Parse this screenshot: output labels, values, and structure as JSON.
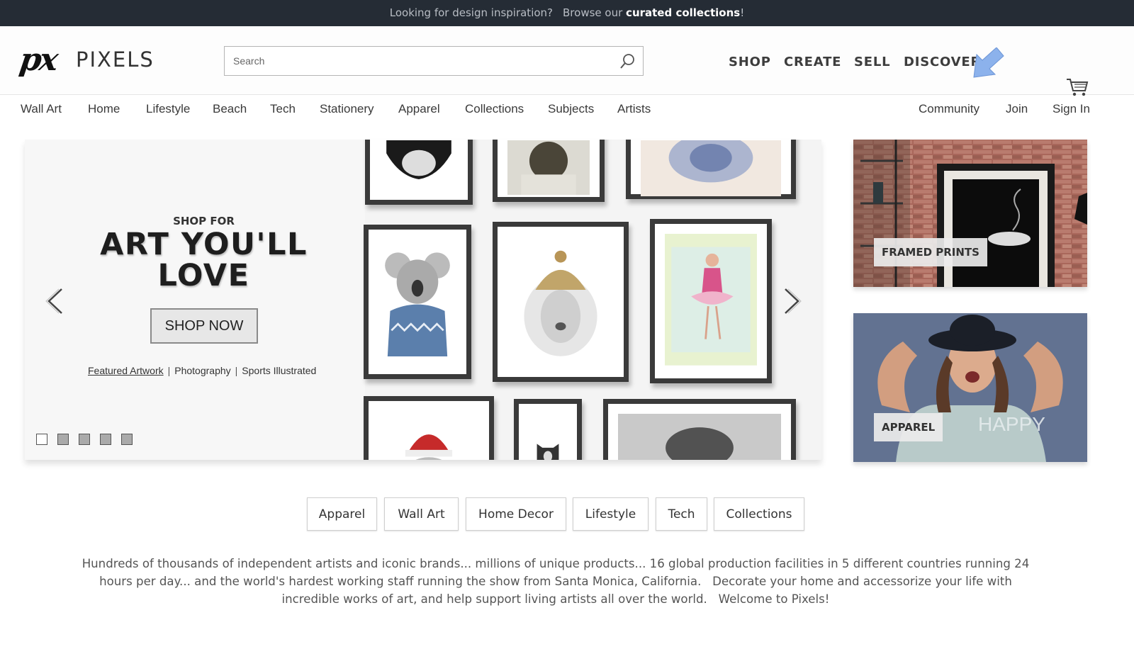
{
  "promo": {
    "text": "Looking for design inspiration?",
    "browse": "Browse our",
    "link": "curated collections",
    "end": "!"
  },
  "header": {
    "logo_mark": "px",
    "logo_text": "PIXELS",
    "search_placeholder": "Search",
    "nav": [
      "SHOP",
      "CREATE",
      "SELL",
      "DISCOVER"
    ]
  },
  "subnav": {
    "left": [
      "Wall Art",
      "Home",
      "Lifestyle",
      "Beach",
      "Tech",
      "Stationery",
      "Apparel",
      "Collections",
      "Subjects",
      "Artists"
    ],
    "right": [
      "Community",
      "Join",
      "Sign In"
    ]
  },
  "hero": {
    "kicker": "SHOP FOR",
    "headline_line1": "ART YOU'LL",
    "headline_line2": "LOVE",
    "cta": "SHOP NOW",
    "links": [
      "Featured Artwork",
      "Photography",
      "Sports Illustrated"
    ],
    "slide_count": 5,
    "active_slide": 1
  },
  "side_tiles": [
    {
      "label": "FRAMED PRINTS"
    },
    {
      "label": "APPAREL",
      "shirt_text": "HAPPY"
    }
  ],
  "categories": [
    "Apparel",
    "Wall Art",
    "Home Decor",
    "Lifestyle",
    "Tech",
    "Collections"
  ],
  "blurb": {
    "line1": "Hundreds of thousands of independent artists and iconic brands... millions of unique products... 16 global production facilities in 5 different countries running 24",
    "line2": "hours per day... and the world's hardest working staff running the show from Santa Monica, California.   Decorate your home and accessorize your life with",
    "line3": "incredible works of art, and help support living artists all over the world.   Welcome to Pixels!"
  },
  "colors": {
    "topbar": "#252c35",
    "accent_arrow": "#7da7e8"
  }
}
